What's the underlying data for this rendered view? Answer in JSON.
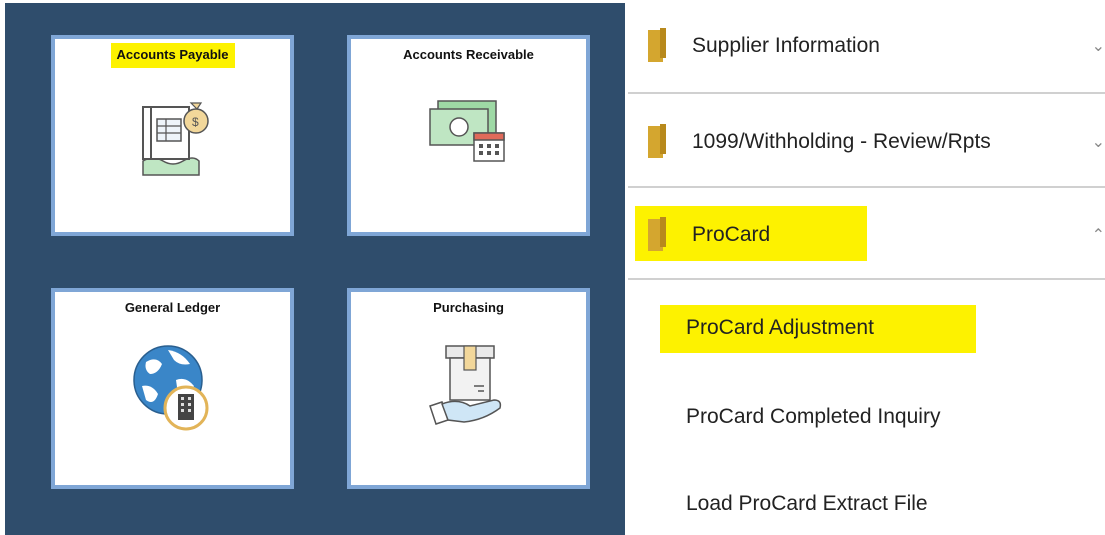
{
  "tiles": [
    {
      "title": "Accounts Payable",
      "icon": "invoice-moneybag-icon"
    },
    {
      "title": "Accounts Receivable",
      "icon": "cash-calendar-icon"
    },
    {
      "title": "General Ledger",
      "icon": "globe-building-icon"
    },
    {
      "title": "Purchasing",
      "icon": "box-hand-icon"
    }
  ],
  "menu": {
    "folders": [
      {
        "label": "Supplier Information",
        "icon": "folder-icon",
        "state": "collapsed"
      },
      {
        "label": "1099/Withholding - Review/Rpts",
        "icon": "folder-icon",
        "state": "collapsed"
      },
      {
        "label": "ProCard",
        "icon": "folder-icon",
        "state": "expanded"
      }
    ],
    "sub_items": [
      {
        "label": "ProCard Adjustment"
      },
      {
        "label": "ProCard Completed Inquiry"
      },
      {
        "label": "Load ProCard Extract File"
      }
    ]
  },
  "colors": {
    "panel_bg": "#2f4d6c",
    "tile_border": "#7fa6d6",
    "highlight": "#fdf200",
    "folder": "#d4a62f"
  }
}
